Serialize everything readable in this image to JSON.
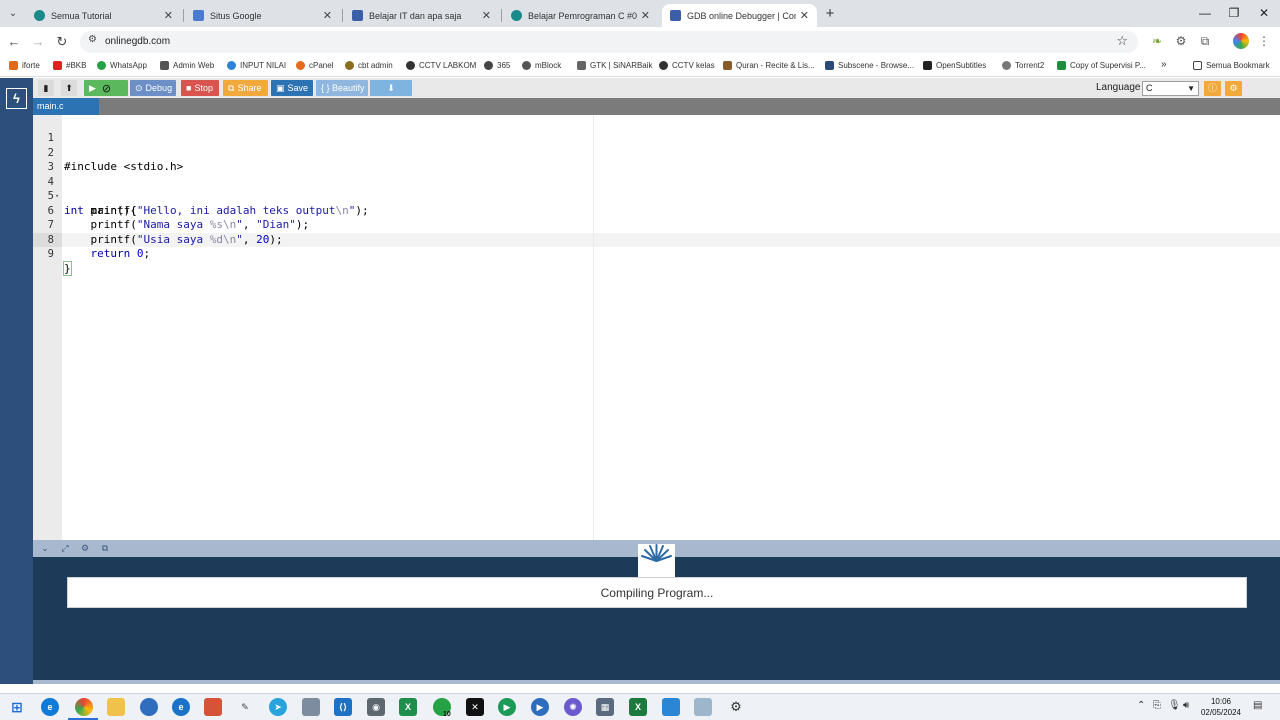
{
  "browser": {
    "tabs": [
      {
        "title": "Semua Tutorial",
        "icon": "circle-teal-icon",
        "color": "#1a8a8a"
      },
      {
        "title": "Situs Google",
        "icon": "document-blue-icon",
        "color": "#4a7bd1"
      },
      {
        "title": "Belajar IT dan apa saja",
        "icon": "blogger-icon",
        "color": "#3b5ea6"
      },
      {
        "title": "Belajar Pemrograman C #04: M",
        "icon": "circle-teal-icon",
        "color": "#1a8a8a"
      },
      {
        "title": "GDB online Debugger | Compil",
        "icon": "gdb-icon",
        "color": "#3a5ea8"
      }
    ],
    "url": "onlinegdb.com",
    "bookmarks": [
      {
        "label": "iforte",
        "color": "#e06a1b"
      },
      {
        "label": "#BKB",
        "color": "#e02020"
      },
      {
        "label": "WhatsApp",
        "color": "#25a244"
      },
      {
        "label": "Admin Web",
        "color": "#555555"
      },
      {
        "label": "INPUT NILAI",
        "color": "#2e82d8"
      },
      {
        "label": "cPanel",
        "color": "#e36b1e"
      },
      {
        "label": "cbt admin",
        "color": "#8a6d1e"
      },
      {
        "label": "CCTV LABKOM",
        "color": "#333333"
      },
      {
        "label": "365",
        "color": "#444444"
      },
      {
        "label": "mBlock",
        "color": "#555555"
      },
      {
        "label": "GTK | SiNARBaik",
        "color": "#666666"
      },
      {
        "label": "CCTV kelas",
        "color": "#333333"
      },
      {
        "label": "Quran - Recite & Lis...",
        "color": "#8a5a2b"
      },
      {
        "label": "Subscene - Browse...",
        "color": "#2a4a7a"
      },
      {
        "label": "OpenSubtitles",
        "color": "#222222"
      },
      {
        "label": "Torrent2",
        "color": "#777777"
      },
      {
        "label": "Copy of Supervisi P...",
        "color": "#1e8e3e"
      }
    ],
    "bookmarks_more": "»",
    "all_bookmarks": "Semua Bookmark"
  },
  "toolbar": {
    "run": "▶",
    "debug": "Debug",
    "stop": "Stop",
    "share": "Share",
    "save": "Save",
    "beautify": "{ } Beautify",
    "download": "⬇",
    "language_label": "Language",
    "language_value": "C"
  },
  "file_tab": "main.c",
  "code": {
    "line_numbers": [
      "1",
      "2",
      "3",
      "4",
      "5",
      "6",
      "7",
      "8",
      "9"
    ],
    "include": "#include <stdio.h>",
    "l4_type": "int",
    "l4_rest": " main(){",
    "l5_fn": "    printf(",
    "l5_str1": "\"Hello, ini adalah teks output",
    "l5_esc": "\\n",
    "l5_str2": "\"",
    "l5_end": ");",
    "l6_fn": "    printf(",
    "l6_str1": "\"Nama saya ",
    "l6_fmt": "%s\\n",
    "l6_str2": "\"",
    "l6_mid": ", ",
    "l6_arg": "\"Dian\"",
    "l6_end": ");",
    "l7_fn": "    printf(",
    "l7_str1": "\"Usia saya ",
    "l7_fmt": "%d\\n",
    "l7_str2": "\"",
    "l7_mid": ", ",
    "l7_num": "20",
    "l7_end": ");",
    "l8_kw": "    return",
    "l8_sp": " ",
    "l8_num": "0",
    "l8_end": ";",
    "l9": "}"
  },
  "output": {
    "status": "Compiling Program..."
  },
  "taskbar": {
    "time": "10:06",
    "date": "02/05/2024",
    "whatsapp_badge": "10"
  },
  "colors": {
    "rail": "#2d4f7b",
    "run": "#5cb85c",
    "debug": "#6b8fc6",
    "stop": "#d9534f",
    "share": "#f0a93a",
    "save": "#2c73b4",
    "beautify": "#8fb6de",
    "download": "#7fb4e0"
  }
}
